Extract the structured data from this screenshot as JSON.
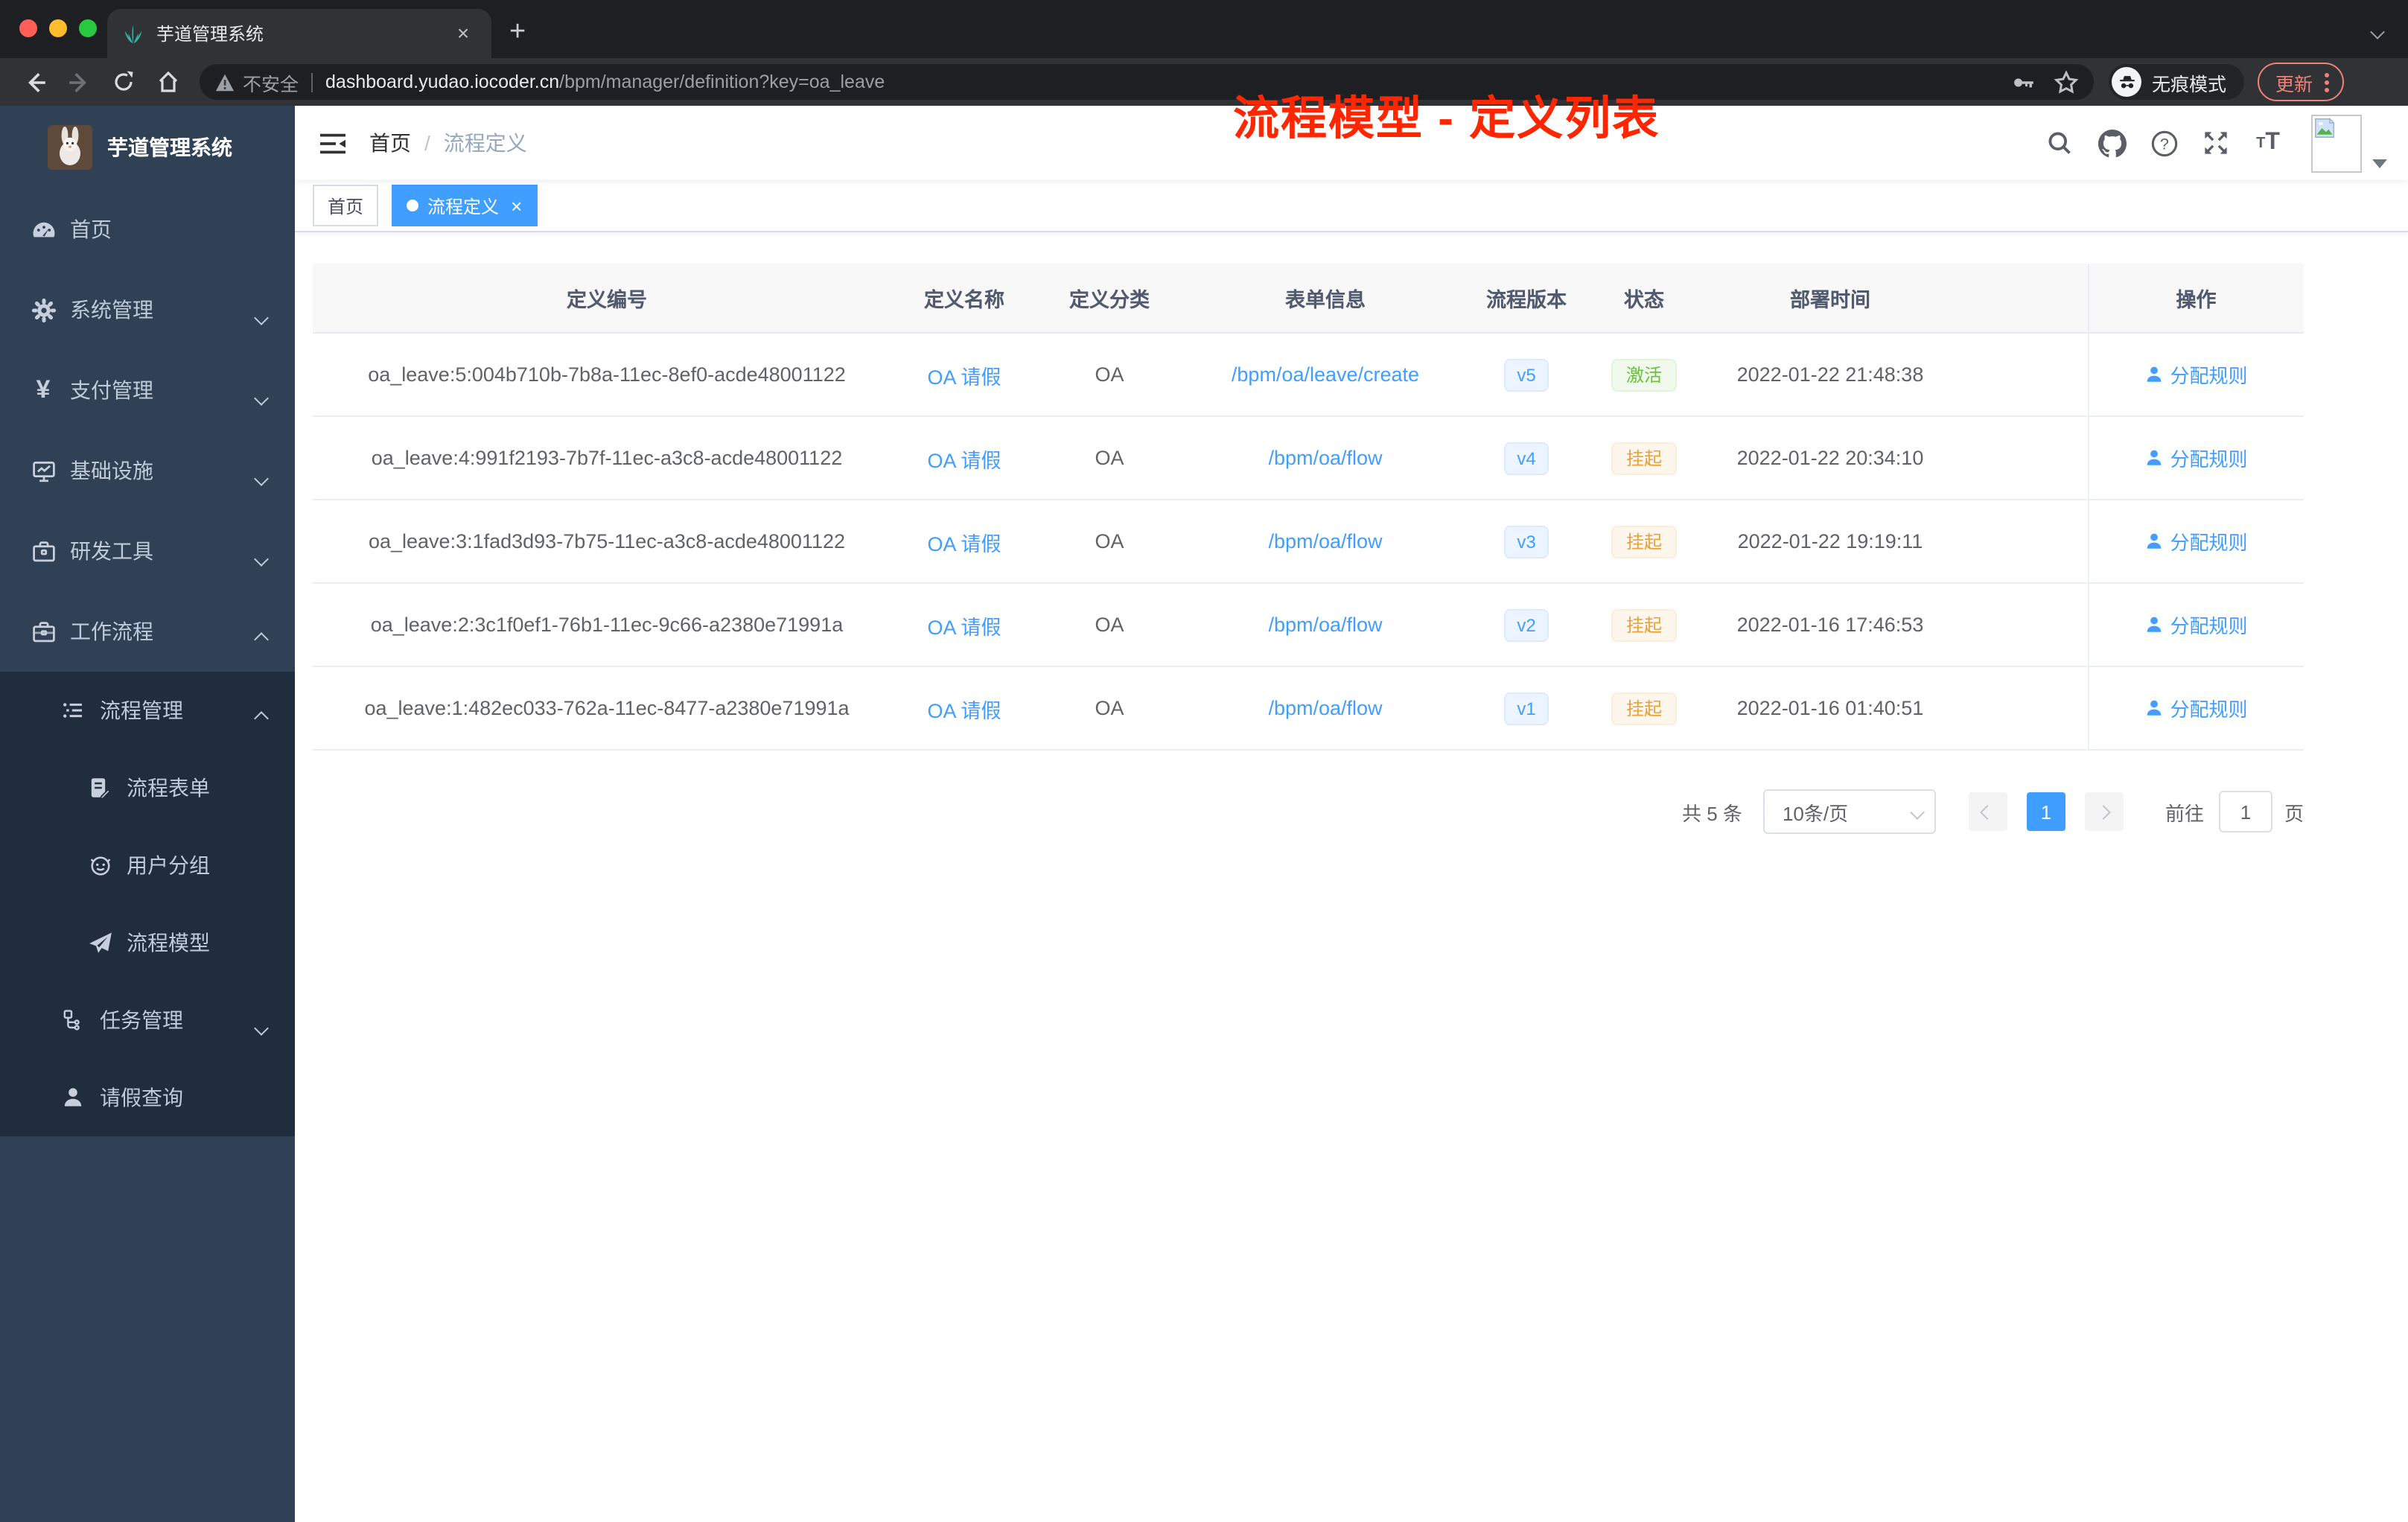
{
  "browser": {
    "tab_title": "芋道管理系统",
    "new_tab": "+",
    "close_tab": "×",
    "security_label": "不安全",
    "url_host": "dashboard.yudao.iocoder.cn",
    "url_path": "/bpm/manager/definition?key=oa_leave",
    "incognito_label": "无痕模式",
    "update_label": "更新"
  },
  "sidebar": {
    "app_title": "芋道管理系统",
    "items": [
      {
        "label": "首页",
        "icon": "dashboard-icon"
      },
      {
        "label": "系统管理",
        "icon": "gear-icon",
        "chevron": "down"
      },
      {
        "label": "支付管理",
        "icon": "yen-icon",
        "chevron": "down"
      },
      {
        "label": "基础设施",
        "icon": "monitor-icon",
        "chevron": "down"
      },
      {
        "label": "研发工具",
        "icon": "toolbox-icon",
        "chevron": "down"
      },
      {
        "label": "工作流程",
        "icon": "briefcase-icon",
        "chevron": "up"
      },
      {
        "label": "流程管理",
        "icon": "list-icon",
        "chevron": "up"
      },
      {
        "label": "流程表单",
        "icon": "form-icon"
      },
      {
        "label": "用户分组",
        "icon": "robot-icon"
      },
      {
        "label": "流程模型",
        "icon": "paper-plane-icon"
      },
      {
        "label": "任务管理",
        "icon": "tree-icon",
        "chevron": "down"
      },
      {
        "label": "请假查询",
        "icon": "user-icon"
      }
    ]
  },
  "header": {
    "breadcrumb_home": "首页",
    "breadcrumb_sep": "/",
    "breadcrumb_current": "流程定义",
    "annotation": "流程模型 - 定义列表",
    "icons": [
      "search-icon",
      "github-icon",
      "help-icon",
      "fullscreen-icon",
      "font-size-icon"
    ]
  },
  "tags": {
    "home": "首页",
    "active": "流程定义",
    "active_close": "×"
  },
  "table": {
    "columns": [
      "定义编号",
      "定义名称",
      "定义分类",
      "表单信息",
      "流程版本",
      "状态",
      "部署时间",
      "操作"
    ],
    "rows": [
      {
        "id": "oa_leave:5:004b710b-7b8a-11ec-8ef0-acde48001122",
        "name": "OA 请假",
        "category": "OA",
        "form": "/bpm/oa/leave/create",
        "version": "v5",
        "status": "激活",
        "status_type": "success",
        "time": "2022-01-22 21:48:38",
        "action": "分配规则"
      },
      {
        "id": "oa_leave:4:991f2193-7b7f-11ec-a3c8-acde48001122",
        "name": "OA 请假",
        "category": "OA",
        "form": "/bpm/oa/flow",
        "version": "v4",
        "status": "挂起",
        "status_type": "warning",
        "time": "2022-01-22 20:34:10",
        "action": "分配规则"
      },
      {
        "id": "oa_leave:3:1fad3d93-7b75-11ec-a3c8-acde48001122",
        "name": "OA 请假",
        "category": "OA",
        "form": "/bpm/oa/flow",
        "version": "v3",
        "status": "挂起",
        "status_type": "warning",
        "time": "2022-01-22 19:19:11",
        "action": "分配规则"
      },
      {
        "id": "oa_leave:2:3c1f0ef1-76b1-11ec-9c66-a2380e71991a",
        "name": "OA 请假",
        "category": "OA",
        "form": "/bpm/oa/flow",
        "version": "v2",
        "status": "挂起",
        "status_type": "warning",
        "time": "2022-01-16 17:46:53",
        "action": "分配规则"
      },
      {
        "id": "oa_leave:1:482ec033-762a-11ec-8477-a2380e71991a",
        "name": "OA 请假",
        "category": "OA",
        "form": "/bpm/oa/flow",
        "version": "v1",
        "status": "挂起",
        "status_type": "warning",
        "time": "2022-01-16 01:40:51",
        "action": "分配规则"
      }
    ]
  },
  "pagination": {
    "total": "共 5 条",
    "page_size": "10条/页",
    "page": "1",
    "goto_label": "前往",
    "goto_value": "1",
    "unit_label": "页"
  },
  "colors": {
    "accent": "#409eff",
    "annotation": "#ff2600",
    "success": "#67c23a",
    "warning": "#e6a23c",
    "sidebar_bg": "#304156",
    "submenu_bg": "#1f2d3d",
    "active_tag_bg": "#409eff"
  }
}
